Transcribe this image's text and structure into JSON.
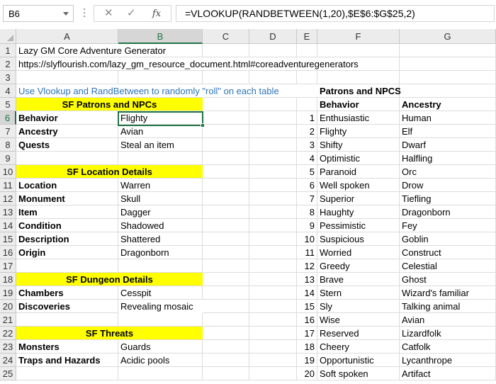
{
  "namebox": "B6",
  "formula": "=VLOOKUP(RANDBETWEEN(1,20),$E$6:$G$25,2)",
  "formula_buttons": {
    "cancel": "✕",
    "enter": "✓",
    "fx": "fx"
  },
  "columns": [
    "A",
    "B",
    "C",
    "D",
    "E",
    "F",
    "G"
  ],
  "rows": {
    "r1": {
      "num": "1",
      "A": "Lazy GM Core Adventure Generator"
    },
    "r2": {
      "num": "2",
      "A": "https://slyflourish.com/lazy_gm_resource_document.html#coreadventuregenerators"
    },
    "r3": {
      "num": "3"
    },
    "r4": {
      "num": "4",
      "A": "Use Vlookup and RandBetween to randomly \"roll\" on each table",
      "F": "Patrons and NPCS"
    },
    "r5": {
      "num": "5",
      "AB": "SF Patrons and NPCs",
      "F": "Behavior",
      "G": "Ancestry"
    },
    "r6": {
      "num": "6",
      "A": "Behavior",
      "B": "Flighty",
      "E": "1",
      "F": "Enthusiastic",
      "G": "Human"
    },
    "r7": {
      "num": "7",
      "A": "Ancestry",
      "B": "Avian",
      "E": "2",
      "F": "Flighty",
      "G": "Elf"
    },
    "r8": {
      "num": "8",
      "A": "Quests",
      "B": "Steal an item",
      "E": "3",
      "F": "Shifty",
      "G": "Dwarf"
    },
    "r9": {
      "num": "9",
      "E": "4",
      "F": "Optimistic",
      "G": "Halfling"
    },
    "r10": {
      "num": "10",
      "AB": "SF Location Details",
      "E": "5",
      "F": "Paranoid",
      "G": "Orc"
    },
    "r11": {
      "num": "11",
      "A": "Location",
      "B": "Warren",
      "E": "6",
      "F": "Well spoken",
      "G": "Drow"
    },
    "r12": {
      "num": "12",
      "A": "Monument",
      "B": "Skull",
      "E": "7",
      "F": "Superior",
      "G": "Tiefling"
    },
    "r13": {
      "num": "13",
      "A": "Item",
      "B": "Dagger",
      "E": "8",
      "F": "Haughty",
      "G": "Dragonborn"
    },
    "r14": {
      "num": "14",
      "A": "Condition",
      "B": "Shadowed",
      "E": "9",
      "F": "Pessimistic",
      "G": "Fey"
    },
    "r15": {
      "num": "15",
      "A": "Description",
      "B": "Shattered",
      "E": "10",
      "F": "Suspicious",
      "G": "Goblin"
    },
    "r16": {
      "num": "16",
      "A": "Origin",
      "B": "Dragonborn",
      "E": "11",
      "F": "Worried",
      "G": "Construct"
    },
    "r17": {
      "num": "17",
      "E": "12",
      "F": "Greedy",
      "G": "Celestial"
    },
    "r18": {
      "num": "18",
      "AB": "SF Dungeon Details",
      "E": "13",
      "F": "Brave",
      "G": "Ghost"
    },
    "r19": {
      "num": "19",
      "A": "Chambers",
      "B": "Cesspit",
      "E": "14",
      "F": "Stern",
      "G": "Wizard's familiar"
    },
    "r20": {
      "num": "20",
      "A": "Discoveries",
      "B": "Revealing mosaic",
      "E": "15",
      "F": "Sly",
      "G": "Talking animal"
    },
    "r21": {
      "num": "21",
      "E": "16",
      "F": "Wise",
      "G": "Avian"
    },
    "r22": {
      "num": "22",
      "AB": "SF Threats",
      "E": "17",
      "F": "Reserved",
      "G": "Lizardfolk"
    },
    "r23": {
      "num": "23",
      "A": "Monsters",
      "B": "Guards",
      "E": "18",
      "F": "Cheery",
      "G": "Catfolk"
    },
    "r24": {
      "num": "24",
      "A": "Traps and Hazards",
      "B": "Acidic pools",
      "E": "19",
      "F": "Opportunistic",
      "G": "Lycanthrope"
    },
    "r25": {
      "num": "25",
      "E": "20",
      "F": "Soft spoken",
      "G": "Artifact"
    }
  },
  "colors": {
    "selection": "#217346",
    "highlight": "#ffff00",
    "link": "#2e75b6"
  }
}
